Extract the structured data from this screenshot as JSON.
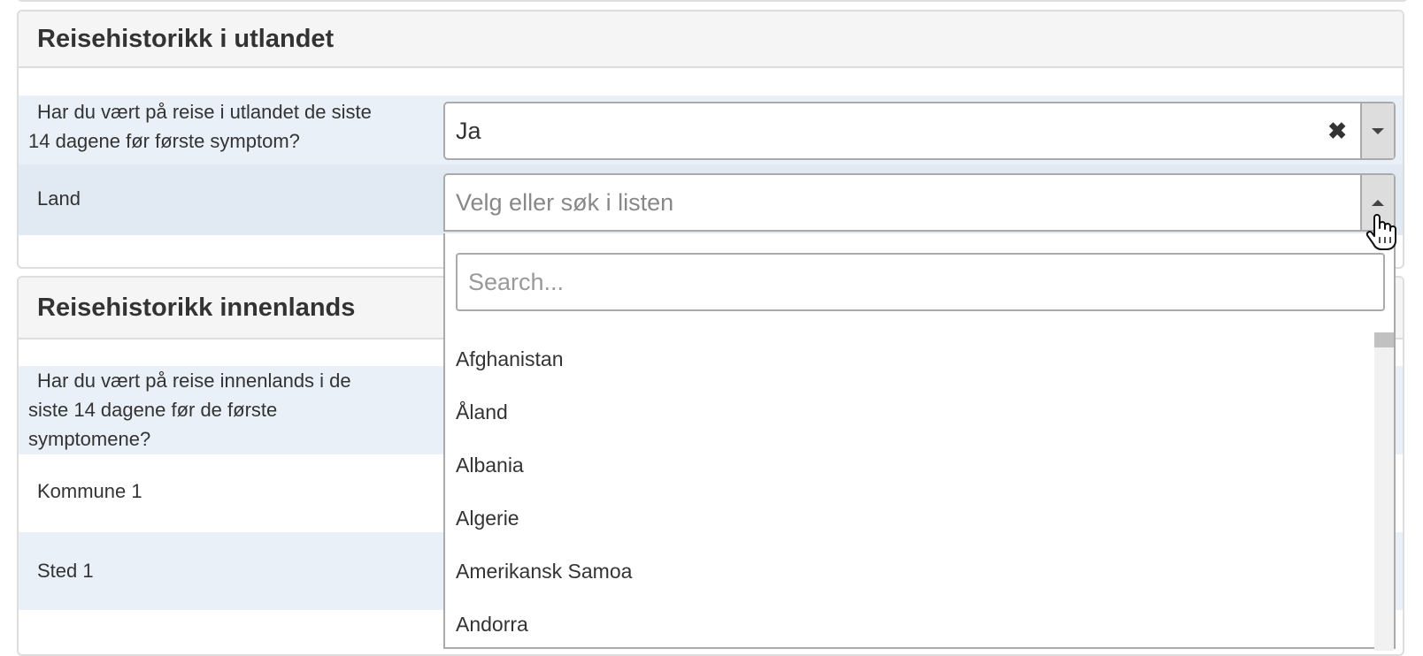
{
  "section_utland": {
    "title": "Reisehistorikk i utlandet",
    "question_line1": "Har du vært på reise i utlandet de siste",
    "question_line2": "14 dagene før første symptom?",
    "answer_value": "Ja",
    "clear_glyph": "✖",
    "land_label": "Land",
    "land_placeholder": "Velg eller søk i listen"
  },
  "section_innenlands": {
    "title": "Reisehistorikk innenlands",
    "question_line1": "Har du vært på reise innenlands i de",
    "question_line2": "siste 14 dagene før de første",
    "question_line3": "symptomene?",
    "kommune_label": "Kommune 1",
    "sted_label": "Sted 1"
  },
  "dropdown": {
    "search_placeholder": "Search...",
    "options": [
      "Afghanistan",
      "Åland",
      "Albania",
      "Algerie",
      "Amerikansk Samoa",
      "Andorra"
    ]
  },
  "icons": {
    "clear": "close-icon",
    "arrow_down": "chevron-down-icon",
    "arrow_up": "chevron-up-icon",
    "cursor": "hand-pointer-icon"
  },
  "colors": {
    "row_shade": "#eaf0f7",
    "row_shade_focus": "#e1e9f3",
    "heading_bg": "#f5f5f5",
    "border": "#aaaaaa"
  }
}
